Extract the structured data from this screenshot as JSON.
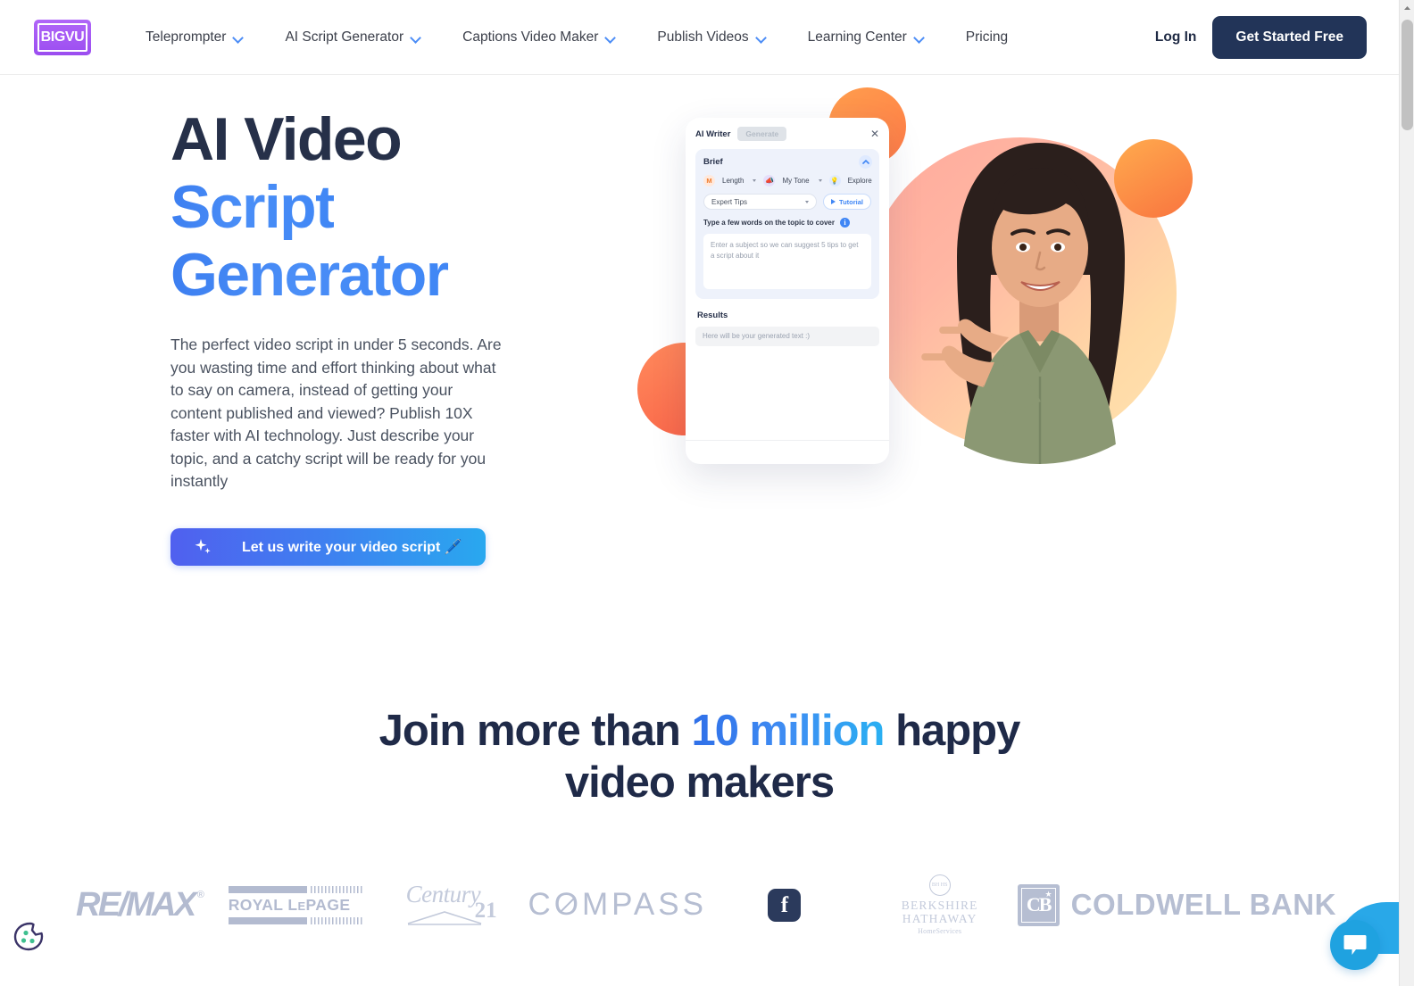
{
  "brand": {
    "logo_text": "BIGVU",
    "logo_color": "#a855f7"
  },
  "header": {
    "nav": [
      {
        "label": "Teleprompter",
        "has_dropdown": true
      },
      {
        "label": "AI Script Generator",
        "has_dropdown": true
      },
      {
        "label": "Captions Video Maker",
        "has_dropdown": true
      },
      {
        "label": "Publish Videos",
        "has_dropdown": true
      },
      {
        "label": "Learning Center",
        "has_dropdown": true
      },
      {
        "label": "Pricing",
        "has_dropdown": false
      }
    ],
    "login_label": "Log In",
    "cta_label": "Get Started Free",
    "cta_color": "#223458"
  },
  "hero": {
    "title_line1": "AI Video",
    "title_line2": "Script",
    "title_line3": "Generator",
    "title_line1_color": "#263049",
    "title_gradient_color": "#3f86f5",
    "paragraph": "The perfect video script in under 5 seconds. Are you wasting time and effort thinking about what to say on camera, instead of getting your content published and viewed? Publish 10X faster with AI technology. Just describe your topic, and a catchy script will be ready for you instantly",
    "cta_label": "Let us write your video script 🖊️",
    "cta_icon": "sparkle-icon"
  },
  "mockup": {
    "app_title": "AI Writer",
    "generate_label": "Generate",
    "close_icon": "close-icon",
    "brief_label": "Brief",
    "collapse_icon": "chevron-up-icon",
    "length_badge": "M",
    "length_label": "Length",
    "tone_icon": "megaphone-icon",
    "tone_label": "My Tone",
    "explore_icon": "lightbulb-icon",
    "explore_label": "Explore",
    "select_value": "Expert Tips",
    "tutorial_label": "Tutorial",
    "tutorial_icon": "play-icon",
    "topic_label": "Type a few words on the topic to cover",
    "info_icon": "info-icon",
    "topic_placeholder": "Enter a subject so we can suggest 5 tips to get a script about it",
    "results_label": "Results",
    "results_placeholder": "Here will be your generated text :)"
  },
  "social_proof": {
    "title_before": "Join more than ",
    "title_highlight": "10 million",
    "title_after": " happy",
    "title_line2": "video makers",
    "highlight_color": "#3f8df3",
    "logos": [
      {
        "name": "remax",
        "label": "RE/MAX",
        "registered": "®"
      },
      {
        "name": "royal-lepage",
        "label_main": "ROYAL L",
        "label_e": "E",
        "label_rest": "PAGE"
      },
      {
        "name": "century21",
        "label": "Century",
        "number": "21"
      },
      {
        "name": "compass",
        "label_a": "C",
        "label_o": "O",
        "label_b": "MPASS"
      },
      {
        "name": "facebook",
        "label": "f"
      },
      {
        "name": "berkshire-hathaway",
        "seal": "BH HS",
        "line1": "BERKSHIRE",
        "line2": "HATHAWAY",
        "sub": "HomeServices"
      },
      {
        "name": "coldwell-banker",
        "mark": "CB",
        "star": "★",
        "label": "COLDWELL BANK"
      }
    ],
    "logo_color": "#b6bed2"
  },
  "widgets": {
    "cookie_icon": "cookie-icon",
    "chat_icon": "chat-bubble-icon",
    "chat_color": "#1fa2e0"
  },
  "scrollbar": {
    "arrow_icon": "scroll-up-arrow-icon"
  }
}
